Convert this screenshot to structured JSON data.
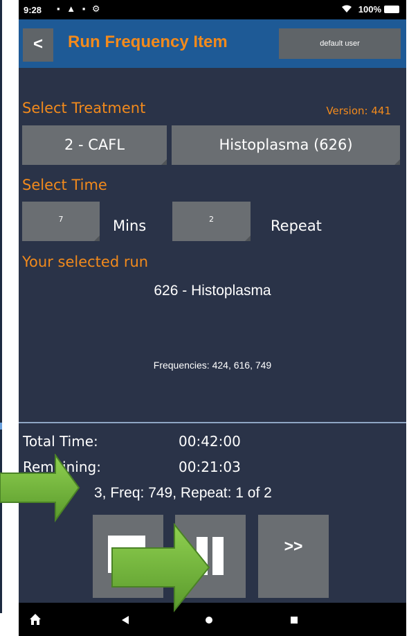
{
  "status_bar": {
    "time": "9:28",
    "left_icons": "▪ ▲ ▪ ⚙",
    "battery": "100%"
  },
  "app_bar": {
    "back_label": "<",
    "title": "Run Frequency Item",
    "user_label": "default user"
  },
  "treatment": {
    "heading": "Select Treatment",
    "version": "Version: 441",
    "program_button": "2 -  CAFL",
    "item_button": "Histoplasma (626)"
  },
  "time": {
    "heading": "Select Time",
    "mins_value": "7",
    "mins_label": "Mins",
    "repeat_value": "2",
    "repeat_label": "Repeat"
  },
  "selected_run": {
    "heading": "Your selected run",
    "name": "626 -  Histoplasma",
    "frequencies": "Frequencies: 424, 616, 749"
  },
  "progress": {
    "total_label": "Total Time:",
    "total_value": "00:42:00",
    "remaining_label": "Remaining:",
    "remaining_value": "00:21:03",
    "status": "3, Freq: 749, Repeat: 1 of 2"
  },
  "controls": {
    "next_label": ">>"
  },
  "colors": {
    "accent": "#f28a1c",
    "app_bar": "#1e5a96",
    "background": "#2a3348",
    "button": "#6a6e72",
    "annotation_arrow": "#7cc043"
  },
  "icons": [
    "stop-icon",
    "pause-icon",
    "home-icon",
    "nav-back-icon",
    "nav-home-icon",
    "nav-recents-icon"
  ]
}
